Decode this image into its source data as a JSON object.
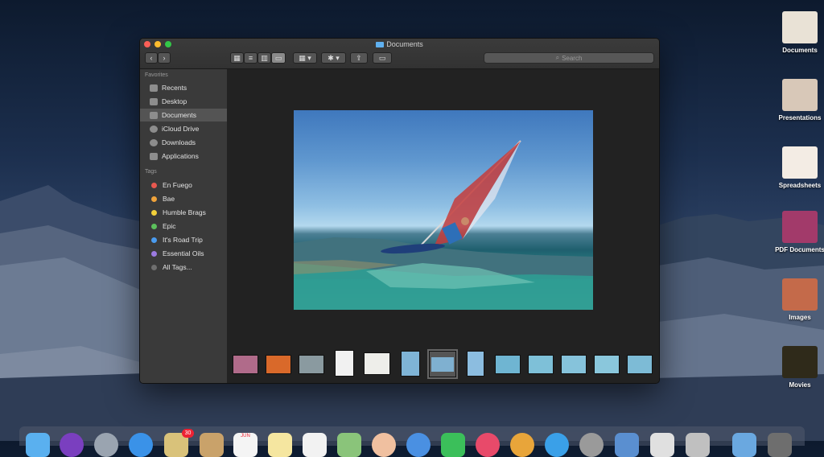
{
  "window": {
    "title": "Documents",
    "search_placeholder": "Search"
  },
  "sidebar": {
    "favorites_header": "Favorites",
    "items": [
      {
        "label": "Recents"
      },
      {
        "label": "Desktop"
      },
      {
        "label": "Documents"
      },
      {
        "label": "iCloud Drive"
      },
      {
        "label": "Downloads"
      },
      {
        "label": "Applications"
      }
    ],
    "tags_header": "Tags",
    "tags": [
      {
        "label": "En Fuego",
        "color": "#e8584f"
      },
      {
        "label": "Bae",
        "color": "#f0a33b"
      },
      {
        "label": "Humble Brags",
        "color": "#f2d03a"
      },
      {
        "label": "Epic",
        "color": "#5cc15c"
      },
      {
        "label": "It's Road Trip",
        "color": "#4a9bef"
      },
      {
        "label": "Essential Oils",
        "color": "#9b7ae0"
      },
      {
        "label": "All Tags...",
        "color": "#6f6f6f"
      }
    ]
  },
  "desktop": {
    "stacks": [
      {
        "label": "Documents"
      },
      {
        "label": "Presentations"
      },
      {
        "label": "Spreadsheets"
      },
      {
        "label": "PDF Documents"
      },
      {
        "label": "Images"
      },
      {
        "label": "Movies"
      }
    ]
  },
  "dock": {
    "calendar_badge": "30",
    "calendar_month": "JUN"
  }
}
